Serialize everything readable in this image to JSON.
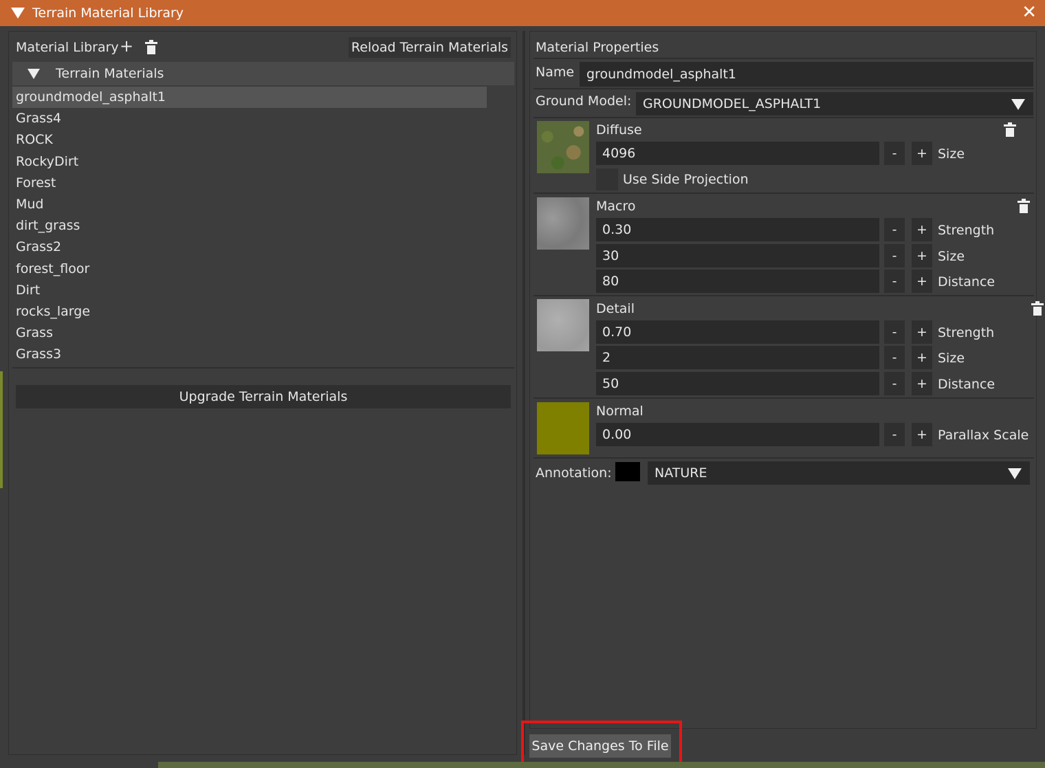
{
  "window": {
    "title": "Terrain Material Library"
  },
  "library": {
    "title": "Material Library",
    "reload_label": "Reload Terrain Materials",
    "tree_header": "Terrain Materials",
    "materials": [
      "groundmodel_asphalt1",
      "Grass4",
      "ROCK",
      "RockyDirt",
      "Forest",
      "Mud",
      "dirt_grass",
      "Grass2",
      "forest_floor",
      "Dirt",
      "rocks_large",
      "Grass",
      "Grass3"
    ],
    "selected_index": 0,
    "upgrade_label": "Upgrade Terrain Materials"
  },
  "properties": {
    "title": "Material Properties",
    "name_label": "Name",
    "name_value": "groundmodel_asphalt1",
    "ground_model_label": "Ground Model:",
    "ground_model_value": "GROUNDMODEL_ASPHALT1",
    "diffuse": {
      "label": "Diffuse",
      "size_value": "4096",
      "size_label": "Size",
      "side_projection_label": "Use Side Projection"
    },
    "macro": {
      "label": "Macro",
      "strength_value": "0.30",
      "strength_label": "Strength",
      "size_value": "30",
      "size_label": "Size",
      "distance_value": "80",
      "distance_label": "Distance"
    },
    "detail": {
      "label": "Detail",
      "strength_value": "0.70",
      "strength_label": "Strength",
      "size_value": "2",
      "size_label": "Size",
      "distance_value": "50",
      "distance_label": "Distance"
    },
    "normal": {
      "label": "Normal",
      "parallax_value": "0.00",
      "parallax_label": "Parallax Scale",
      "swatch_color": "#7f7f00"
    },
    "annotation_label": "Annotation:",
    "annotation_value": "NATURE",
    "annotation_color": "#000000"
  },
  "stepper": {
    "minus": "-",
    "plus": "+"
  },
  "icons": {
    "add": "+",
    "close": "✕"
  },
  "save_label": "Save Changes To File",
  "colors": {
    "title_bar": "#c8662f",
    "highlight": "#e81515"
  }
}
